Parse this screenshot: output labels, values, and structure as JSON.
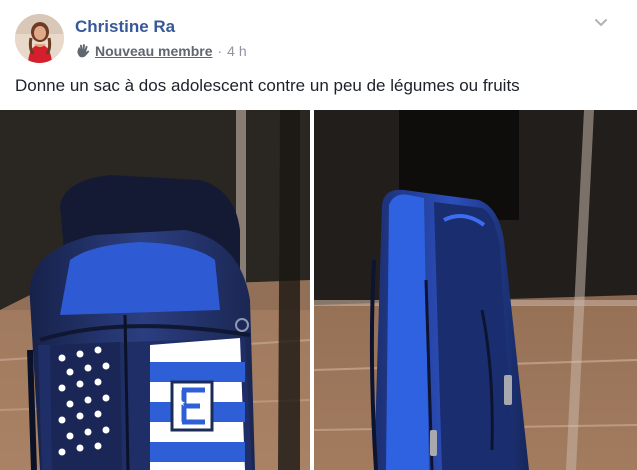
{
  "post": {
    "author": "Christine Ra",
    "badge": "Nouveau membre",
    "badge_icon": "wave-hand-icon",
    "separator": "·",
    "time": "4 h",
    "text": "Donne un sac à dos adolescent contre un peu de légumes ou fruits",
    "menu_icon": "chevron-down-icon"
  },
  "photos": [
    {
      "subject": "backpack-front-photo"
    },
    {
      "subject": "backpack-side-photo"
    }
  ],
  "colors": {
    "author": "#385898",
    "meta": "#616770",
    "text": "#1d2129",
    "backpack_blue": "#2a5bd7",
    "backpack_navy": "#1c2c58"
  }
}
